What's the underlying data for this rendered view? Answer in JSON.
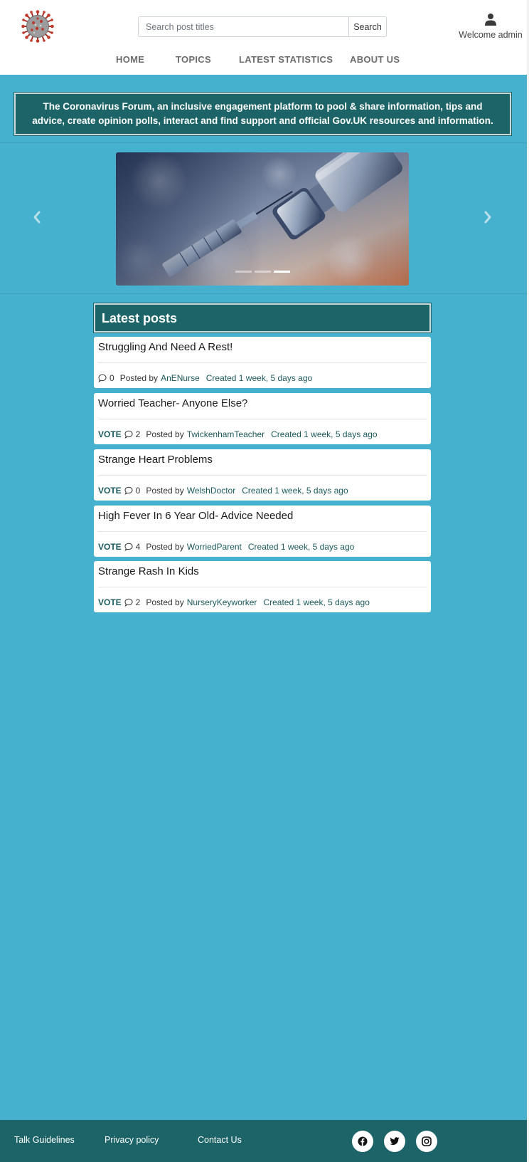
{
  "header": {
    "search": {
      "placeholder": "Search post titles",
      "button_label": "Search"
    },
    "user": {
      "welcome": "Welcome admin",
      "icon": "user-icon"
    },
    "logo": {
      "icon": "coronavirus-logo-icon"
    },
    "nav": [
      {
        "label": "HOME"
      },
      {
        "label": "TOPICS"
      },
      {
        "label": "LATEST STATISTICS"
      },
      {
        "label": "ABOUT US"
      }
    ]
  },
  "banner": {
    "text": "The Coronavirus Forum, an inclusive engagement platform to pool & share information, tips and advice, create opinion polls, interact and find support and official Gov.UK resources and information."
  },
  "carousel": {
    "slides_count": 3,
    "active_index": 2,
    "prev_icon": "chevron-left-icon",
    "next_icon": "chevron-right-icon"
  },
  "posts": {
    "heading": "Latest posts",
    "items": [
      {
        "title": "Struggling And Need A Rest!",
        "vote": "",
        "comments": "0",
        "posted_by": "Posted by",
        "author": "AnENurse",
        "created": "Created 1 week, 5 days ago"
      },
      {
        "title": "Worried Teacher- Anyone Else?",
        "vote": "VOTE",
        "comments": "2",
        "posted_by": "Posted by",
        "author": "TwickenhamTeacher",
        "created": "Created 1 week, 5 days ago"
      },
      {
        "title": "Strange Heart Problems",
        "vote": "VOTE",
        "comments": "0",
        "posted_by": "Posted by",
        "author": "WelshDoctor",
        "created": "Created 1 week, 5 days ago"
      },
      {
        "title": "High Fever In 6 Year Old- Advice Needed",
        "vote": "VOTE",
        "comments": "4",
        "posted_by": "Posted by",
        "author": "WorriedParent",
        "created": "Created 1 week, 5 days ago"
      },
      {
        "title": "Strange Rash In Kids",
        "vote": "VOTE",
        "comments": "2",
        "posted_by": "Posted by",
        "author": "NurseryKeyworker",
        "created": "Created 1 week, 5 days ago"
      }
    ]
  },
  "footer": {
    "links": [
      {
        "label": "Talk Guidelines"
      },
      {
        "label": "Privacy policy"
      },
      {
        "label": "Contact Us"
      }
    ],
    "social": [
      "facebook-icon",
      "twitter-icon",
      "instagram-icon"
    ]
  },
  "colors": {
    "page_background": "#45b1ce",
    "brand_dark": "#1c6468",
    "link": "#1c5a5e",
    "header_background": "#ffffff"
  }
}
